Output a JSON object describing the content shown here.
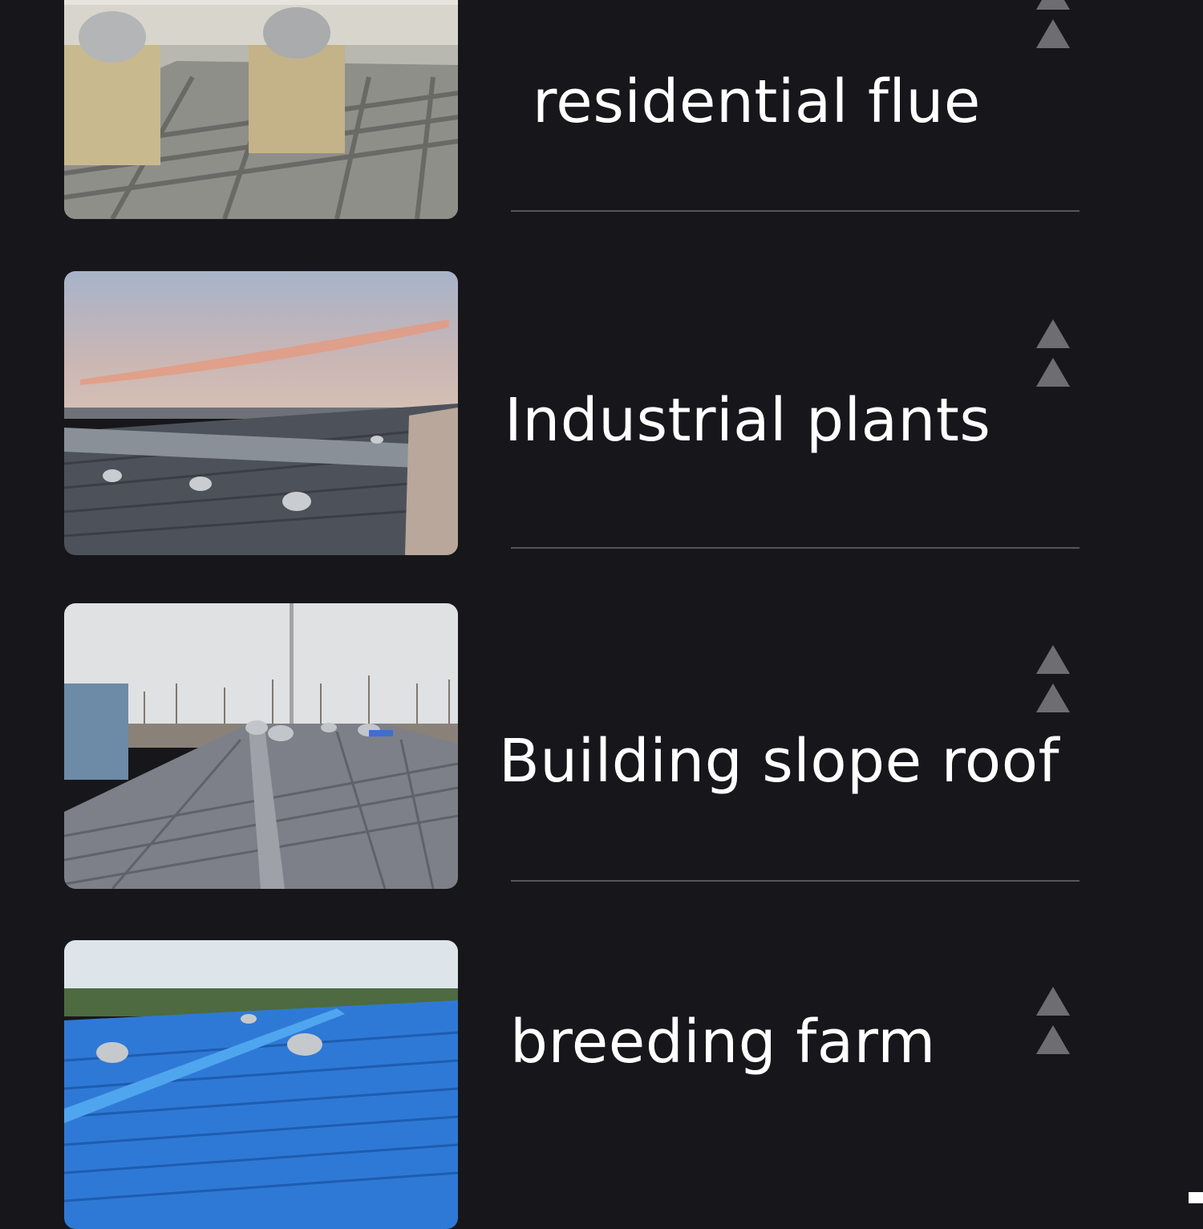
{
  "sections": [
    {
      "label": "residential flue",
      "photo_icon": "rooftop-chimney-ventilator-photo"
    },
    {
      "label": "Industrial plants",
      "photo_icon": "industrial-roof-ventilators-photo"
    },
    {
      "label": "Building slope roof",
      "photo_icon": "tiled-slope-roof-ventilators-photo"
    },
    {
      "label": "breeding farm",
      "photo_icon": "blue-farm-roof-ventilators-photo"
    }
  ],
  "colors": {
    "background": "#17171b",
    "text": "#ffffff",
    "divider": "#55555a",
    "arrow": "#6e6e72"
  }
}
